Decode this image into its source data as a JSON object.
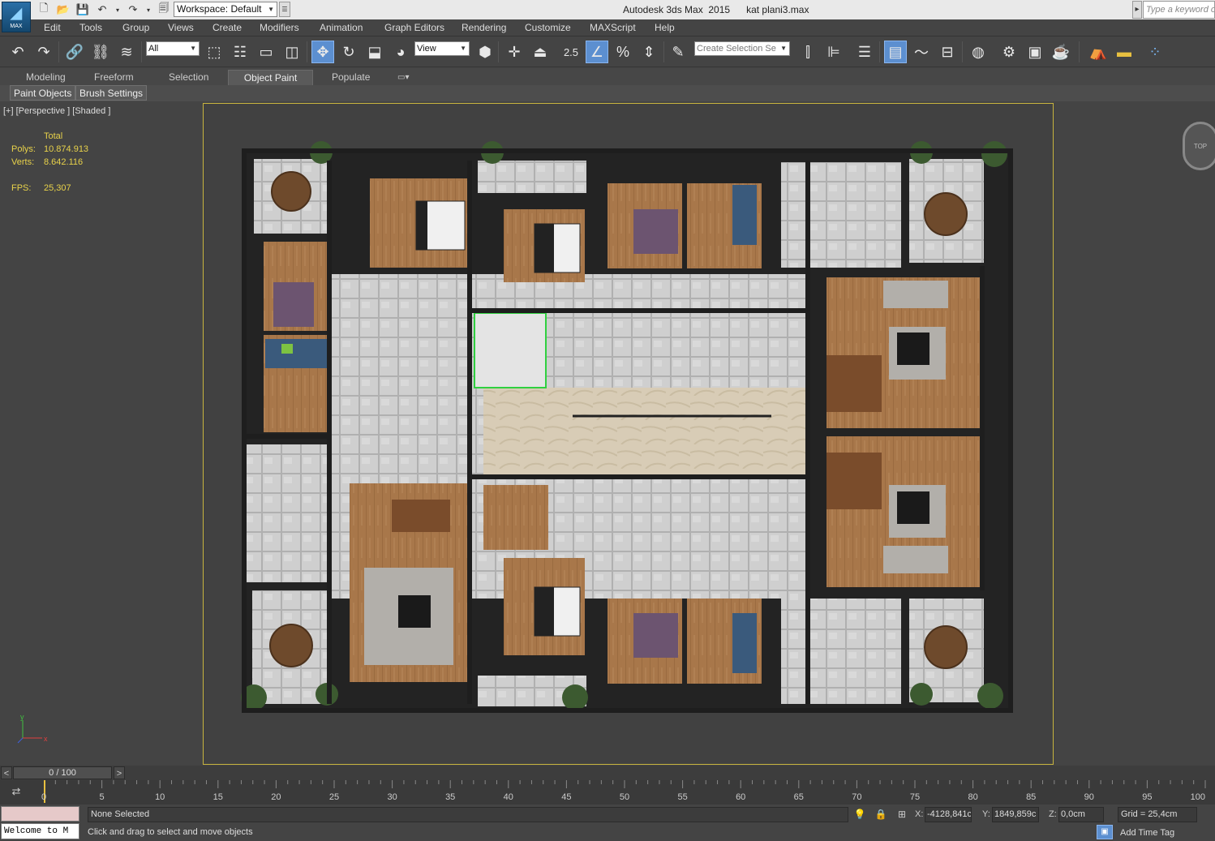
{
  "app": {
    "logo_text": "MAX",
    "window_title": "Autodesk 3ds Max  2015      kat plani3.max",
    "workspace": "Workspace: Default",
    "search_placeholder": "Type a keyword or"
  },
  "menu": [
    "Edit",
    "Tools",
    "Group",
    "Views",
    "Create",
    "Modifiers",
    "Animation",
    "Graph Editors",
    "Rendering",
    "Customize",
    "MAXScript",
    "Help"
  ],
  "toolbar": {
    "selection_filter": "All",
    "reference_coord": "View",
    "snap_value": "2.5",
    "named_selection_placeholder": "Create Selection Se"
  },
  "ribbon": {
    "tabs": [
      "Modeling",
      "Freeform",
      "Selection",
      "Object Paint",
      "Populate"
    ],
    "active_tab": "Object Paint",
    "subtabs": [
      "Paint Objects",
      "Brush Settings"
    ]
  },
  "viewport": {
    "label": "[+] [Perspective ] [Shaded ]",
    "stats": {
      "header": "Total",
      "polys_label": "Polys:",
      "polys": "10.874.913",
      "verts_label": "Verts:",
      "verts": "8.642.116",
      "fps_label": "FPS:",
      "fps": "25,307"
    },
    "viewcube_label": "TOP",
    "axis_x": "x",
    "axis_y": "y"
  },
  "timeline": {
    "position": "0 / 100",
    "ticks": [
      "0",
      "5",
      "10",
      "15",
      "20",
      "25",
      "30",
      "35",
      "40",
      "45",
      "50",
      "55",
      "60",
      "65",
      "70",
      "75",
      "80",
      "85",
      "90",
      "95",
      "100"
    ]
  },
  "status": {
    "maxscript_listener": "Welcome to M",
    "selection": "None Selected",
    "prompt": "Click and drag to select and move objects",
    "x_label": "X:",
    "x_value": "-4128,841c",
    "y_label": "Y:",
    "y_value": "1849,859c",
    "z_label": "Z:",
    "z_value": "0,0cm",
    "grid": "Grid = 25,4cm",
    "add_time_tag": "Add Time Tag"
  },
  "colors": {
    "ui_bg": "#444444",
    "safe_frame": "#c8b43e",
    "stats_text": "#e8d24a",
    "active_button": "#5c8fd0"
  }
}
